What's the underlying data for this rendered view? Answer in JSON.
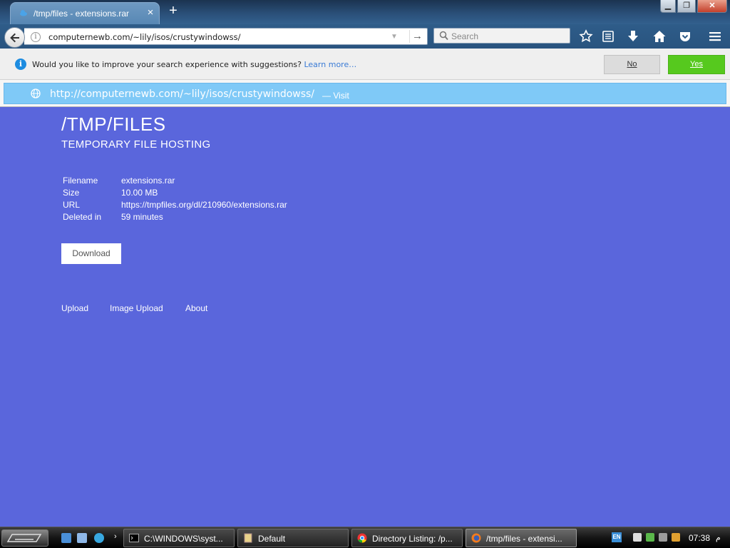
{
  "browser": {
    "tab_title": "/tmp/files - extensions.rar",
    "tab_close": "×",
    "new_tab": "+",
    "window_controls": {
      "minimize": "▁",
      "maximize": "❐",
      "close": "✕"
    },
    "url": "computernewb.com/~lily/isos/crustywindowss/",
    "search_placeholder": "Search"
  },
  "notification": {
    "message": "Would you like to improve your search experience with suggestions?",
    "link": "Learn more…",
    "no_label": "No",
    "yes_label": "Yes"
  },
  "autocomplete": {
    "url": "http://computernewb.com/~lily/isos/crustywindowss/",
    "action": "— Visit"
  },
  "page": {
    "title": "/TMP/FILES",
    "subtitle": "TEMPORARY FILE HOSTING",
    "file_info": [
      {
        "key": "Filename",
        "value": "extensions.rar"
      },
      {
        "key": "Size",
        "value": "10.00 MB"
      },
      {
        "key": "URL",
        "value": "https://tmpfiles.org/dl/210960/extensions.rar"
      },
      {
        "key": "Deleted in",
        "value": "59 minutes"
      }
    ],
    "download_label": "Download",
    "footer_links": [
      "Upload",
      "Image Upload",
      "About"
    ]
  },
  "taskbar": {
    "tasks": [
      {
        "label": "C:\\WINDOWS\\syst..."
      },
      {
        "label": "Default"
      },
      {
        "label": "Directory Listing: /p..."
      },
      {
        "label": "/tmp/files - extensi..."
      }
    ],
    "language": "EN",
    "clock": "07:38",
    "clock_suffix": "م"
  },
  "colors": {
    "page_background": "#5a66dc",
    "yes_button": "#56c91e",
    "autocomplete_highlight": "#7fc9f7"
  }
}
